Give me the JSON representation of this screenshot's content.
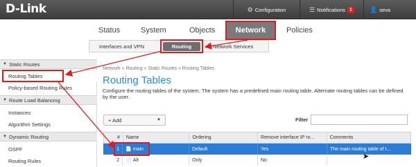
{
  "topbar": {
    "logo": "D-Link",
    "configuration_label": "Configuration",
    "configuration_icon": "gear-icon",
    "notifications_label": "Notifications",
    "notifications_icon": "list-icon",
    "notifications_count": "1",
    "user_label": "seva",
    "user_icon": "user-icon"
  },
  "main_nav": {
    "tabs": [
      {
        "label": "Status"
      },
      {
        "label": "System"
      },
      {
        "label": "Objects"
      },
      {
        "label": "Network",
        "active": true
      },
      {
        "label": "Policies"
      }
    ]
  },
  "sub_nav": {
    "tabs": [
      {
        "label": "Interfaces and VPN"
      },
      {
        "label": "Routing",
        "active": true
      },
      {
        "label": "Network Services"
      }
    ]
  },
  "sidebar": {
    "groups": [
      {
        "label": "Static Routes",
        "items": [
          "Routing Tables",
          "Policy-based Routing Rules"
        ]
      },
      {
        "label": "Route Load Balancing",
        "items": [
          "Instances",
          "Algorithm Settings"
        ]
      },
      {
        "label": "Dynamic Routing",
        "items": [
          "OSPF",
          "Routing Rules"
        ]
      }
    ],
    "selected": "Routing Tables"
  },
  "content": {
    "breadcrumb": "Network » Routing » Static Routes » Routing Tables",
    "title": "Routing Tables",
    "description": "Configure the routing tables of the system. The system has a predefined main routing table. Alternate routing tables can be defined by the user.",
    "add_button": "+ Add",
    "filter_label": "Filter",
    "filter_value": ""
  },
  "table": {
    "columns": [
      "#",
      "Name",
      "Ordering",
      "Remove interface IP ro...",
      "Comments"
    ],
    "rows": [
      {
        "num": "1",
        "name": "main",
        "ordering": "Default",
        "remove_ip": "Yes",
        "comments": "The main routing table of t..."
      },
      {
        "num": "2",
        "name": "Alt",
        "ordering": "Only",
        "remove_ip": "No",
        "comments": ""
      }
    ],
    "selected_row": 1
  },
  "colors": {
    "accent_title": "#2a8fc5",
    "selected_row": "#2b7cd6",
    "annotation_red": "#e11b1b",
    "topbar": "#4a4a4a"
  }
}
